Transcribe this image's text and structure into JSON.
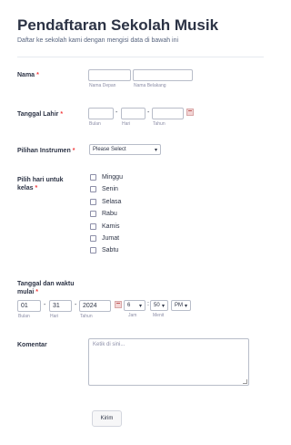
{
  "header": {
    "title": "Pendaftaran Sekolah Musik",
    "subtitle": "Daftar ke sekolah kami dengan mengisi data di bawah ini"
  },
  "name": {
    "label": "Nama",
    "required_mark": "*",
    "first_value": "",
    "last_value": "",
    "first_sub": "Nama Depan",
    "last_sub": "Nama Belakang"
  },
  "birthdate": {
    "label": "Tanggal Lahir",
    "required_mark": "*",
    "month_value": "",
    "day_value": "",
    "year_value": "",
    "separator": "-",
    "month_sub": "Bulan",
    "day_sub": "Hari",
    "year_sub": "Tahun",
    "calendar_icon": "calendar-icon"
  },
  "instrument": {
    "label": "Pilihan Instrumen",
    "required_mark": "*",
    "selected": "Please Select",
    "chevron": "▾"
  },
  "days": {
    "label_line1": "Pilih hari untuk",
    "label_line2": "kelas",
    "required_mark": "*",
    "options": [
      "Minggu",
      "Senin",
      "Selasa",
      "Rabu",
      "Kamis",
      "Jumat",
      "Sabtu"
    ]
  },
  "start": {
    "label_line1": "Tanggal dan waktu",
    "label_line2": "mulai",
    "required_mark": "*",
    "month_value": "01",
    "day_value": "31",
    "year_value": "2024",
    "separator": "-",
    "time_separator": ":",
    "hour_value": "6",
    "minute_value": "50",
    "ampm_value": "PM",
    "chevron": "▾",
    "month_sub": "Bulan",
    "day_sub": "Hari",
    "year_sub": "Tahun",
    "hour_sub": "Jam",
    "minute_sub": "Menit",
    "calendar_icon": "calendar-icon"
  },
  "comment": {
    "label": "Komentar",
    "placeholder": "Ketik di sini..."
  },
  "submit": {
    "label": "Kirim"
  }
}
